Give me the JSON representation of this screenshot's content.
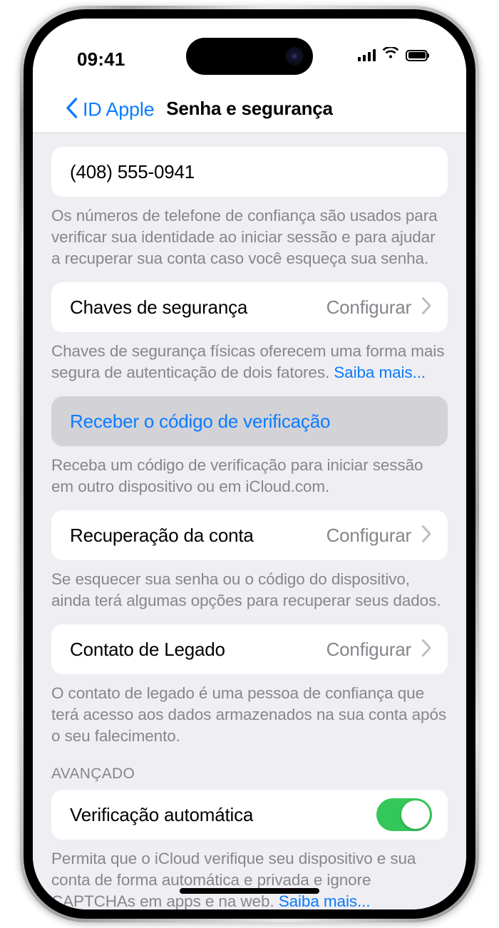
{
  "status_bar": {
    "time": "09:41",
    "cellular_icon": "cellular-bars-icon",
    "wifi_icon": "wifi-icon",
    "battery_icon": "battery-full-icon"
  },
  "nav": {
    "back_label": "ID Apple",
    "back_icon": "chevron-left-icon",
    "title": "Senha e segurança"
  },
  "content": {
    "phone_number": "(408) 555-0941",
    "phone_footnote": "Os números de telefone de confiança são usados para verificar sua identidade ao iniciar sessão e para ajudar a recuperar sua conta caso você esqueça sua senha.",
    "security_keys": {
      "title": "Chaves de segurança",
      "value": "Configurar",
      "chevron_icon": "chevron-right-icon"
    },
    "security_keys_footnote": "Chaves de segurança físicas oferecem uma forma mais segura de autenticação de dois fatores. ",
    "security_keys_link": "Saiba mais...",
    "verification_code": {
      "label": "Receber o código de verificação"
    },
    "verification_code_footnote": "Receba um código de verificação para iniciar sessão em outro dispositivo ou em iCloud.com.",
    "account_recovery": {
      "title": "Recuperação da conta",
      "value": "Configurar",
      "chevron_icon": "chevron-right-icon"
    },
    "account_recovery_footnote": "Se esquecer sua senha ou o código do dispositivo, ainda terá algumas opções para recuperar seus dados.",
    "legacy_contact": {
      "title": "Contato de Legado",
      "value": "Configurar",
      "chevron_icon": "chevron-right-icon"
    },
    "legacy_contact_footnote": "O contato de legado é uma pessoa de confiança que terá acesso aos dados armazenados na sua conta após o seu falecimento.",
    "advanced_header": "AVANÇADO",
    "automatic_verification": {
      "title": "Verificação automática",
      "toggle_state": "on"
    },
    "automatic_verification_footnote": "Permita que o iCloud verifique seu dispositivo e sua conta de forma automática e privada e ignore CAPTCHAs em apps e na web. ",
    "automatic_verification_link": "Saiba mais..."
  },
  "colors": {
    "accent_blue": "#0a7cff",
    "toggle_green": "#34c759",
    "page_background": "#efeef3",
    "card_background": "#ffffff",
    "highlight_background": "#d3d2d7",
    "secondary_text": "#86868b"
  }
}
